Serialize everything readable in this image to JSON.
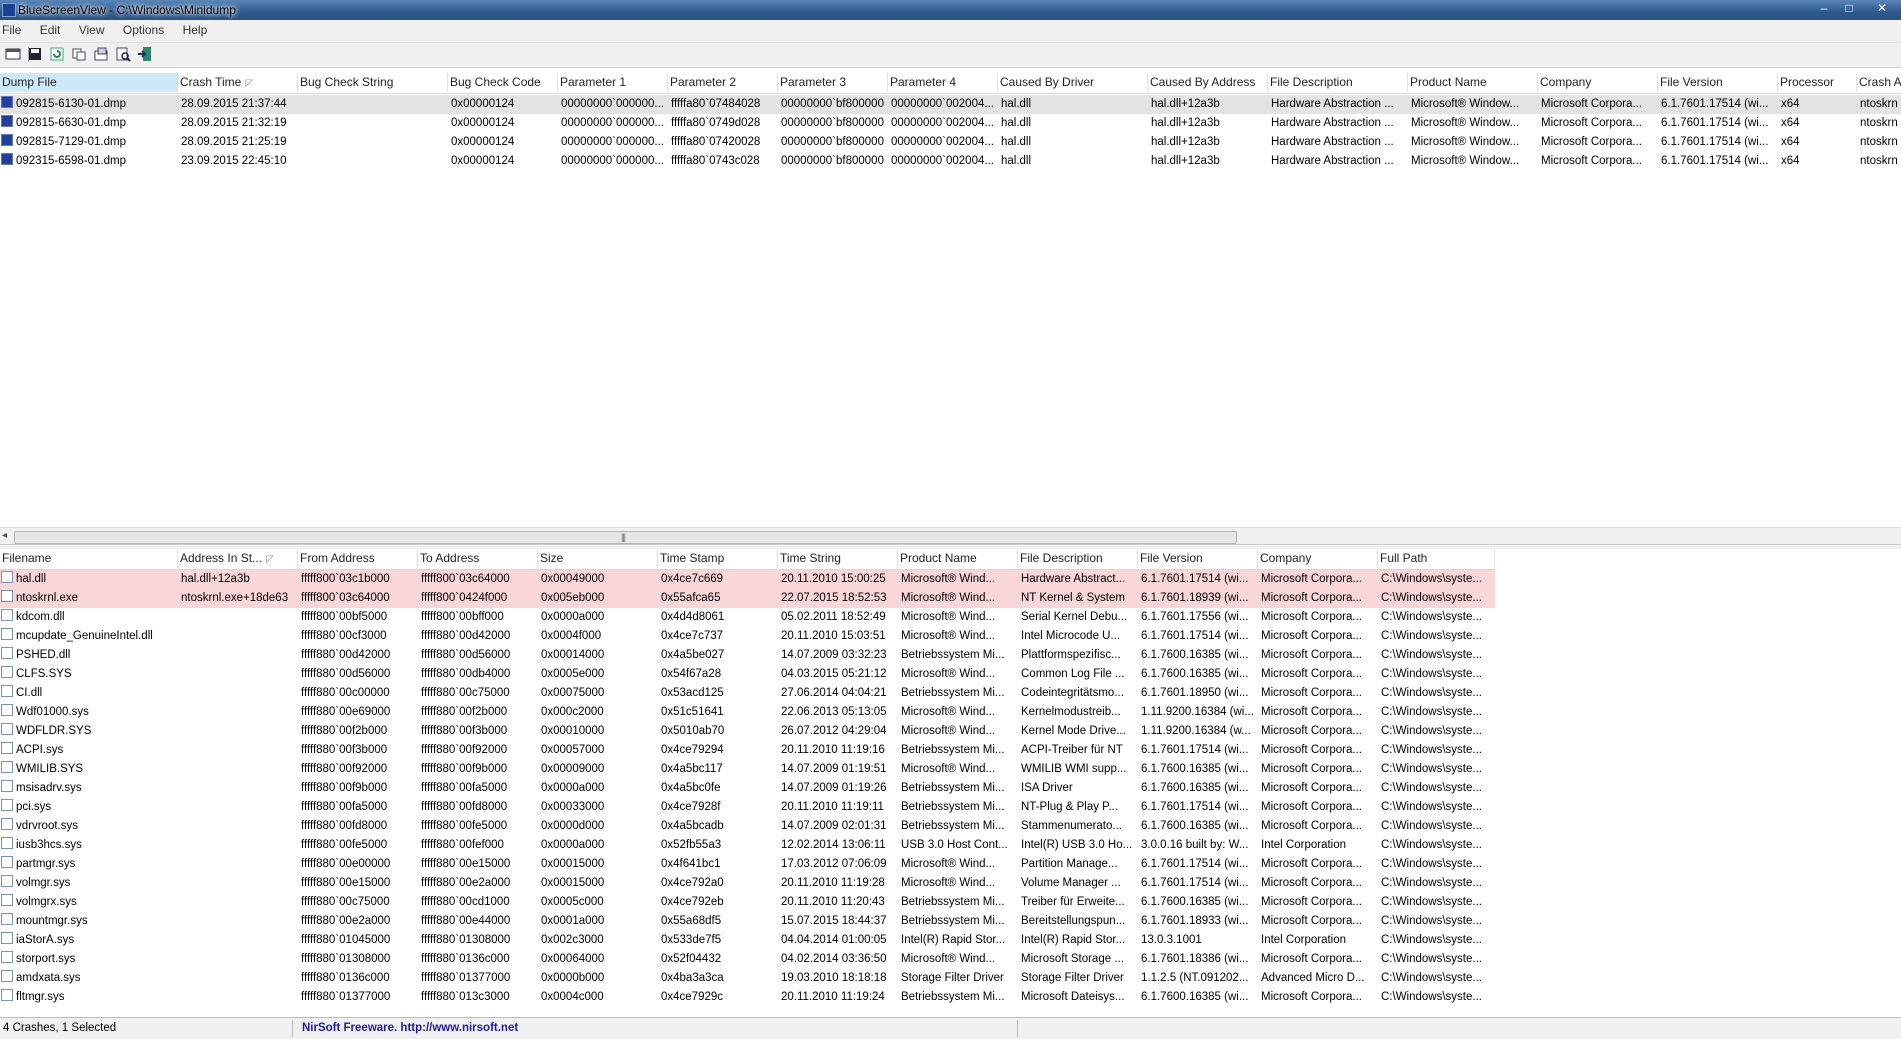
{
  "window": {
    "title": "BlueScreenView  -  C:\\Windows\\Minidump",
    "minimize": "‒",
    "maximize": "□",
    "close": "✕"
  },
  "menu": [
    "File",
    "Edit",
    "View",
    "Options",
    "Help"
  ],
  "toolbar_icons": [
    "save-html-report-icon",
    "save-icon",
    "refresh-icon",
    "copy-icon",
    "properties-icon",
    "find-icon",
    "exit-icon"
  ],
  "crashes": {
    "columns": [
      {
        "label": "Dump File"
      },
      {
        "label": "Crash Time",
        "sort": "◸"
      },
      {
        "label": "Bug Check String"
      },
      {
        "label": "Bug Check Code"
      },
      {
        "label": "Parameter 1"
      },
      {
        "label": "Parameter 2"
      },
      {
        "label": "Parameter 3"
      },
      {
        "label": "Parameter 4"
      },
      {
        "label": "Caused By Driver"
      },
      {
        "label": "Caused By Address"
      },
      {
        "label": "File Description"
      },
      {
        "label": "Product Name"
      },
      {
        "label": "Company"
      },
      {
        "label": "File Version"
      },
      {
        "label": "Processor"
      },
      {
        "label": "Crash A"
      }
    ],
    "rows": [
      [
        "092815-6130-01.dmp",
        "28.09.2015 21:37:44",
        "",
        "0x00000124",
        "00000000`000000...",
        "fffffa80`07484028",
        "00000000`bf800000",
        "00000000`002004...",
        "hal.dll",
        "hal.dll+12a3b",
        "Hardware Abstraction ...",
        "Microsoft® Window...",
        "Microsoft Corpora...",
        "6.1.7601.17514 (wi...",
        "x64",
        "ntoskrn"
      ],
      [
        "092815-6630-01.dmp",
        "28.09.2015 21:32:19",
        "",
        "0x00000124",
        "00000000`000000...",
        "fffffa80`0749d028",
        "00000000`bf800000",
        "00000000`002004...",
        "hal.dll",
        "hal.dll+12a3b",
        "Hardware Abstraction ...",
        "Microsoft® Window...",
        "Microsoft Corpora...",
        "6.1.7601.17514 (wi...",
        "x64",
        "ntoskrn"
      ],
      [
        "092815-7129-01.dmp",
        "28.09.2015 21:25:19",
        "",
        "0x00000124",
        "00000000`000000...",
        "fffffa80`07420028",
        "00000000`bf800000",
        "00000000`002004...",
        "hal.dll",
        "hal.dll+12a3b",
        "Hardware Abstraction ...",
        "Microsoft® Window...",
        "Microsoft Corpora...",
        "6.1.7601.17514 (wi...",
        "x64",
        "ntoskrn"
      ],
      [
        "092315-6598-01.dmp",
        "23.09.2015 22:45:10",
        "",
        "0x00000124",
        "00000000`000000...",
        "fffffa80`0743c028",
        "00000000`bf800000",
        "00000000`002004...",
        "hal.dll",
        "hal.dll+12a3b",
        "Hardware Abstraction ...",
        "Microsoft® Window...",
        "Microsoft Corpora...",
        "6.1.7601.17514 (wi...",
        "x64",
        "ntoskrn"
      ]
    ]
  },
  "hscroll": {
    "left_arrow": "◂",
    "grip": "|||"
  },
  "drivers": {
    "columns": [
      {
        "label": "Filename"
      },
      {
        "label": "Address In St...",
        "sort": "◸"
      },
      {
        "label": "From Address"
      },
      {
        "label": "To Address"
      },
      {
        "label": "Size"
      },
      {
        "label": "Time Stamp"
      },
      {
        "label": "Time String"
      },
      {
        "label": "Product Name"
      },
      {
        "label": "File Description"
      },
      {
        "label": "File Version"
      },
      {
        "label": "Company"
      },
      {
        "label": "Full Path"
      }
    ],
    "rows": [
      [
        "hal.dll",
        "hal.dll+12a3b",
        "fffff800`03c1b000",
        "fffff800`03c64000",
        "0x00049000",
        "0x4ce7c669",
        "20.11.2010 15:00:25",
        "Microsoft® Wind...",
        "Hardware Abstract...",
        "6.1.7601.17514 (wi...",
        "Microsoft Corpora...",
        "C:\\Windows\\syste..."
      ],
      [
        "ntoskrnl.exe",
        "ntoskrnl.exe+18de63",
        "fffff800`03c64000",
        "fffff800`0424f000",
        "0x005eb000",
        "0x55afca65",
        "22.07.2015 18:52:53",
        "Microsoft® Wind...",
        "NT Kernel & System",
        "6.1.7601.18939 (wi...",
        "Microsoft Corpora...",
        "C:\\Windows\\syste..."
      ],
      [
        "kdcom.dll",
        "",
        "fffff800`00bf5000",
        "fffff800`00bff000",
        "0x0000a000",
        "0x4d4d8061",
        "05.02.2011 18:52:49",
        "Microsoft® Wind...",
        "Serial Kernel Debu...",
        "6.1.7601.17556 (wi...",
        "Microsoft Corpora...",
        "C:\\Windows\\syste..."
      ],
      [
        "mcupdate_GenuineIntel.dll",
        "",
        "fffff880`00cf3000",
        "fffff880`00d42000",
        "0x0004f000",
        "0x4ce7c737",
        "20.11.2010 15:03:51",
        "Microsoft® Wind...",
        "Intel Microcode U...",
        "6.1.7601.17514 (wi...",
        "Microsoft Corpora...",
        "C:\\Windows\\syste..."
      ],
      [
        "PSHED.dll",
        "",
        "fffff880`00d42000",
        "fffff880`00d56000",
        "0x00014000",
        "0x4a5be027",
        "14.07.2009 03:32:23",
        "Betriebssystem Mi...",
        "Plattformspezifisc...",
        "6.1.7600.16385 (wi...",
        "Microsoft Corpora...",
        "C:\\Windows\\syste..."
      ],
      [
        "CLFS.SYS",
        "",
        "fffff880`00d56000",
        "fffff880`00db4000",
        "0x0005e000",
        "0x54f67a28",
        "04.03.2015 05:21:12",
        "Microsoft® Wind...",
        "Common Log File ...",
        "6.1.7600.16385 (wi...",
        "Microsoft Corpora...",
        "C:\\Windows\\syste..."
      ],
      [
        "CI.dll",
        "",
        "fffff880`00c00000",
        "fffff880`00c75000",
        "0x00075000",
        "0x53acd125",
        "27.06.2014 04:04:21",
        "Betriebssystem Mi...",
        "Codeintegritätsmo...",
        "6.1.7601.18950 (wi...",
        "Microsoft Corpora...",
        "C:\\Windows\\syste..."
      ],
      [
        "Wdf01000.sys",
        "",
        "fffff880`00e69000",
        "fffff880`00f2b000",
        "0x000c2000",
        "0x51c51641",
        "22.06.2013 05:13:05",
        "Microsoft® Wind...",
        "Kernelmodustreib...",
        "1.11.9200.16384 (wi...",
        "Microsoft Corpora...",
        "C:\\Windows\\syste..."
      ],
      [
        "WDFLDR.SYS",
        "",
        "fffff880`00f2b000",
        "fffff880`00f3b000",
        "0x00010000",
        "0x5010ab70",
        "26.07.2012 04:29:04",
        "Microsoft® Wind...",
        "Kernel Mode Drive...",
        "1.11.9200.16384 (w...",
        "Microsoft Corpora...",
        "C:\\Windows\\syste..."
      ],
      [
        "ACPI.sys",
        "",
        "fffff880`00f3b000",
        "fffff880`00f92000",
        "0x00057000",
        "0x4ce79294",
        "20.11.2010 11:19:16",
        "Betriebssystem Mi...",
        "ACPI-Treiber für NT",
        "6.1.7601.17514 (wi...",
        "Microsoft Corpora...",
        "C:\\Windows\\syste..."
      ],
      [
        "WMILIB.SYS",
        "",
        "fffff880`00f92000",
        "fffff880`00f9b000",
        "0x00009000",
        "0x4a5bc117",
        "14.07.2009 01:19:51",
        "Microsoft® Wind...",
        "WMILIB WMI supp...",
        "6.1.7600.16385 (wi...",
        "Microsoft Corpora...",
        "C:\\Windows\\syste..."
      ],
      [
        "msisadrv.sys",
        "",
        "fffff880`00f9b000",
        "fffff880`00fa5000",
        "0x0000a000",
        "0x4a5bc0fe",
        "14.07.2009 01:19:26",
        "Betriebssystem Mi...",
        "ISA Driver",
        "6.1.7600.16385 (wi...",
        "Microsoft Corpora...",
        "C:\\Windows\\syste..."
      ],
      [
        "pci.sys",
        "",
        "fffff880`00fa5000",
        "fffff880`00fd8000",
        "0x00033000",
        "0x4ce7928f",
        "20.11.2010 11:19:11",
        "Betriebssystem Mi...",
        "NT-Plug & Play P...",
        "6.1.7601.17514 (wi...",
        "Microsoft Corpora...",
        "C:\\Windows\\syste..."
      ],
      [
        "vdrvroot.sys",
        "",
        "fffff880`00fd8000",
        "fffff880`00fe5000",
        "0x0000d000",
        "0x4a5bcadb",
        "14.07.2009 02:01:31",
        "Betriebssystem Mi...",
        "Stammenumerato...",
        "6.1.7600.16385 (wi...",
        "Microsoft Corpora...",
        "C:\\Windows\\syste..."
      ],
      [
        "iusb3hcs.sys",
        "",
        "fffff880`00fe5000",
        "fffff880`00fef000",
        "0x0000a000",
        "0x52fb55a3",
        "12.02.2014 13:06:11",
        "USB 3.0 Host Cont...",
        "Intel(R) USB 3.0 Ho...",
        "3.0.0.16 built by: W...",
        "Intel Corporation",
        "C:\\Windows\\syste..."
      ],
      [
        "partmgr.sys",
        "",
        "fffff880`00e00000",
        "fffff880`00e15000",
        "0x00015000",
        "0x4f641bc1",
        "17.03.2012 07:06:09",
        "Microsoft® Wind...",
        "Partition Manage...",
        "6.1.7601.17514 (wi...",
        "Microsoft Corpora...",
        "C:\\Windows\\syste..."
      ],
      [
        "volmgr.sys",
        "",
        "fffff880`00e15000",
        "fffff880`00e2a000",
        "0x00015000",
        "0x4ce792a0",
        "20.11.2010 11:19:28",
        "Microsoft® Wind...",
        "Volume Manager ...",
        "6.1.7601.17514 (wi...",
        "Microsoft Corpora...",
        "C:\\Windows\\syste..."
      ],
      [
        "volmgrx.sys",
        "",
        "fffff880`00c75000",
        "fffff880`00cd1000",
        "0x0005c000",
        "0x4ce792eb",
        "20.11.2010 11:20:43",
        "Betriebssystem Mi...",
        "Treiber für Erweite...",
        "6.1.7600.16385 (wi...",
        "Microsoft Corpora...",
        "C:\\Windows\\syste..."
      ],
      [
        "mountmgr.sys",
        "",
        "fffff880`00e2a000",
        "fffff880`00e44000",
        "0x0001a000",
        "0x55a68df5",
        "15.07.2015 18:44:37",
        "Betriebssystem Mi...",
        "Bereitstellungspun...",
        "6.1.7601.18933 (wi...",
        "Microsoft Corpora...",
        "C:\\Windows\\syste..."
      ],
      [
        "iaStorA.sys",
        "",
        "fffff880`01045000",
        "fffff880`01308000",
        "0x002c3000",
        "0x533de7f5",
        "04.04.2014 01:00:05",
        "Intel(R) Rapid Stor...",
        "Intel(R) Rapid Stor...",
        "13.0.3.1001",
        "Intel Corporation",
        "C:\\Windows\\syste..."
      ],
      [
        "storport.sys",
        "",
        "fffff880`01308000",
        "fffff880`0136c000",
        "0x00064000",
        "0x52f04432",
        "04.02.2014 03:36:50",
        "Microsoft® Wind...",
        "Microsoft Storage ...",
        "6.1.7601.18386 (wi...",
        "Microsoft Corpora...",
        "C:\\Windows\\syste..."
      ],
      [
        "amdxata.sys",
        "",
        "fffff880`0136c000",
        "fffff880`01377000",
        "0x0000b000",
        "0x4ba3a3ca",
        "19.03.2010 18:18:18",
        "Storage Filter Driver",
        "Storage Filter Driver",
        "1.1.2.5 (NT.091202...",
        "Advanced Micro D...",
        "C:\\Windows\\syste..."
      ],
      [
        "fltmgr.sys",
        "",
        "fffff880`01377000",
        "fffff880`013c3000",
        "0x0004c000",
        "0x4ce7929c",
        "20.11.2010 11:19:24",
        "Betriebssystem Mi...",
        "Microsoft Dateisys...",
        "6.1.7600.16385 (wi...",
        "Microsoft Corpora...",
        "C:\\Windows\\syste..."
      ]
    ]
  },
  "status": {
    "count": "4 Crashes, 1 Selected",
    "freeware": "NirSoft Freeware.  http://www.nirsoft.net"
  },
  "colors": {
    "selected_header": "#cde8f7",
    "selected_row": "#e3e3e3",
    "highlight_row": "#f9d6d8",
    "status_link": "#1a1ab0"
  }
}
